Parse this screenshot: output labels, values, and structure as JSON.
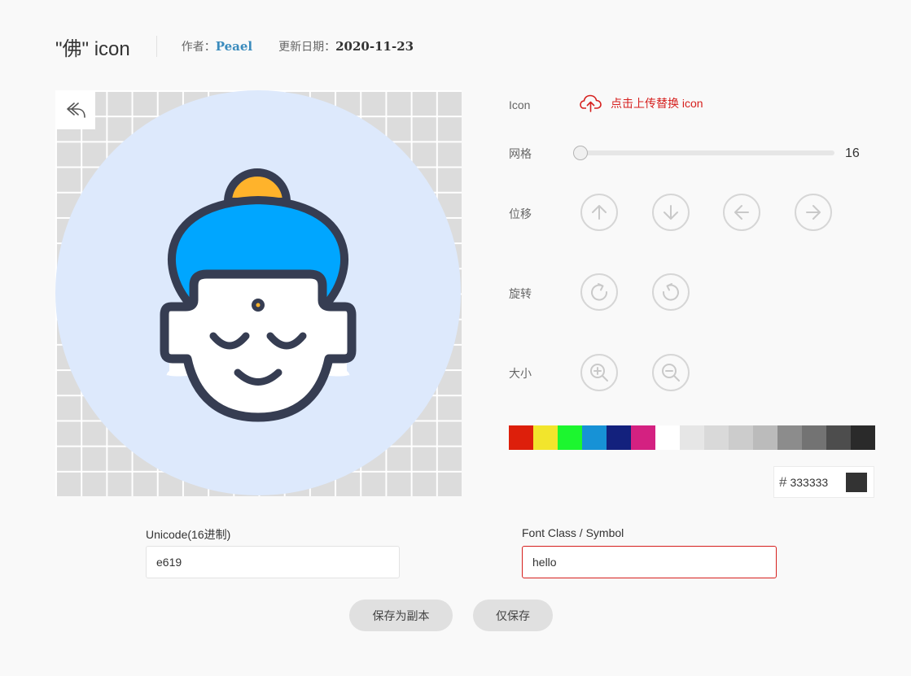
{
  "header": {
    "title": "\"佛\" icon",
    "author_label": "作者：",
    "author": "Peael",
    "date_label": "更新日期：",
    "date": "2020-11-23"
  },
  "canvas": {
    "grid_size": 16,
    "undo_icon": "undo-arrow-icon",
    "icon_name": "buddha-icon"
  },
  "controls": {
    "icon_label": "Icon",
    "upload_icon": "cloud-upload-icon",
    "upload_text": "点击上传替换 icon",
    "grid_label": "网格",
    "grid_value": "16",
    "grid_slider_fraction": 0.0,
    "move_label": "位移",
    "move_buttons": [
      "arrow-up-icon",
      "arrow-down-icon",
      "arrow-left-icon",
      "arrow-right-icon"
    ],
    "rotate_label": "旋转",
    "rotate_buttons": [
      "rotate-clockwise-icon",
      "rotate-counterclockwise-icon"
    ],
    "size_label": "大小",
    "size_buttons": [
      "zoom-in-icon",
      "zoom-out-icon"
    ]
  },
  "palette": {
    "colors": [
      "#dd1f0b",
      "#f2e52c",
      "#1cf62f",
      "#1792d6",
      "#13217d",
      "#d42181",
      "#ffffff",
      "#e6e6e6",
      "#d9d9d9",
      "#cccccc",
      "#bbbbbb",
      "#8c8c8c",
      "#737373",
      "#4d4d4d",
      "#2a2a2a"
    ]
  },
  "color_input": {
    "hash": "#",
    "value": "333333",
    "preview_color": "#333333"
  },
  "form": {
    "unicode_label": "Unicode(16进制)",
    "unicode_value": "e619",
    "fontclass_label": "Font Class / Symbol",
    "fontclass_value": "hello"
  },
  "actions": {
    "save_copy": "保存为副本",
    "save": "仅保存"
  }
}
